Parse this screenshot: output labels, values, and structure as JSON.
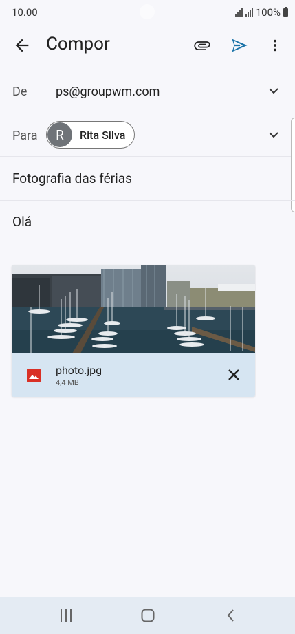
{
  "status": {
    "time": "10.00",
    "battery": "100%"
  },
  "appbar": {
    "title": "Compor"
  },
  "from": {
    "label": "De",
    "value": "ps@groupwm.com"
  },
  "to": {
    "label": "Para",
    "recipient_initial": "R",
    "recipient_name": "Rita Silva"
  },
  "subject": {
    "value": "Fotografia das férias"
  },
  "body": {
    "text": "Olá"
  },
  "attachment": {
    "file_name": "photo.jpg",
    "file_size": "4,4 MB"
  },
  "colors": {
    "accent": "#1a73a8",
    "attachment_bar": "#d6e5f2",
    "image_icon": "#d93025"
  },
  "icons": [
    "back-arrow-icon",
    "paperclip-icon",
    "send-icon",
    "more-vert-icon",
    "chevron-down-icon",
    "image-icon",
    "close-icon",
    "recents-icon",
    "home-icon",
    "nav-back-icon"
  ]
}
